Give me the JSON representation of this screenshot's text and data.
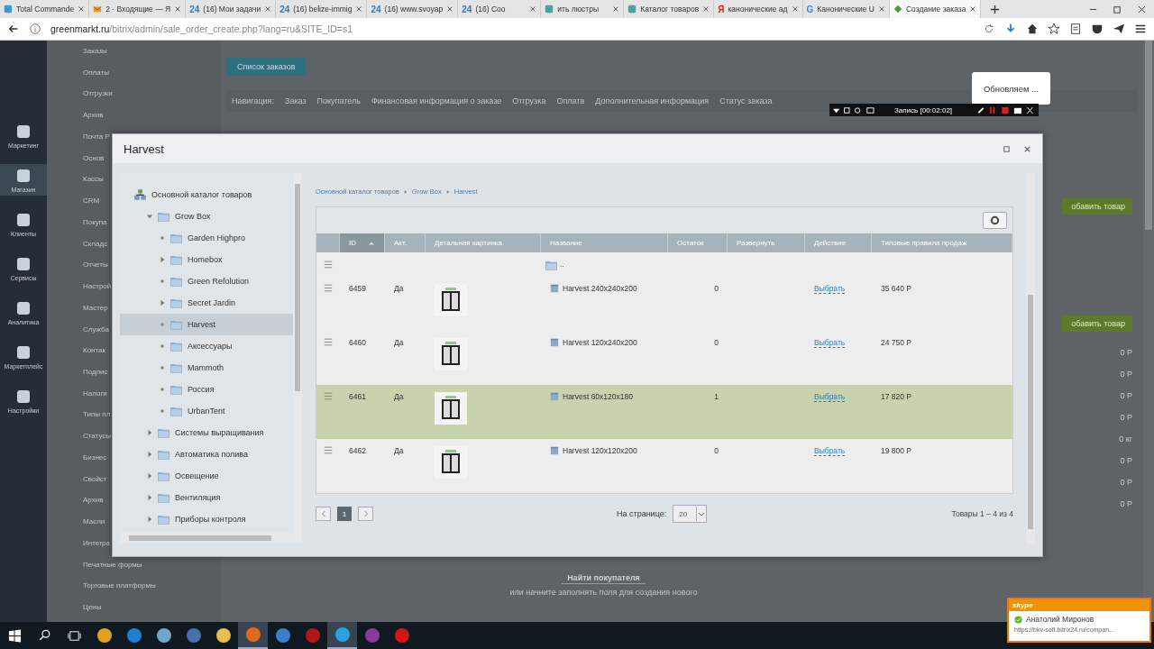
{
  "browser": {
    "tabs": [
      {
        "title": "Total Commande",
        "kind": "square",
        "selected": false
      },
      {
        "title": "2 · Входящие — Я",
        "kind": "envelope",
        "selected": false
      },
      {
        "title": "(16) Мои задачи",
        "kind": "logo",
        "logo": "24",
        "selected": false
      },
      {
        "title": "(16) belize-immig",
        "kind": "logo",
        "logo": "24",
        "selected": false
      },
      {
        "title": "(16) www.svoyap",
        "kind": "logo",
        "logo": "24",
        "selected": false
      },
      {
        "title": "(16) Соо",
        "kind": "logo",
        "logo": "24",
        "selected": false
      },
      {
        "title": "ить люстры",
        "kind": "square",
        "selected": false
      },
      {
        "title": "Каталог товаров",
        "kind": "square",
        "selected": false
      },
      {
        "title": "канонические ад",
        "kind": "logo",
        "logo": "Я",
        "selected": false
      },
      {
        "title": "Канонические U",
        "kind": "logo",
        "logo": "G",
        "selected": false
      },
      {
        "title": "Создание заказа",
        "kind": "leaf",
        "selected": true
      }
    ],
    "url_host": "greenmarkt.ru",
    "url_path": "/bitrix/admin/sale_order_create.php?lang=ru&SITE_ID=s1"
  },
  "rail": [
    {
      "label": "Маркетинг",
      "selected": false
    },
    {
      "label": "Магазин",
      "selected": true
    },
    {
      "label": "Клиенты",
      "selected": false
    },
    {
      "label": "Сервисы",
      "selected": false
    },
    {
      "label": "Аналитика",
      "selected": false
    },
    {
      "label": "Маркетплейс",
      "selected": false
    },
    {
      "label": "Настройки",
      "selected": false
    }
  ],
  "menu": [
    {
      "label": "Заказы"
    },
    {
      "label": "Оплаты"
    },
    {
      "label": "Отгрузки"
    },
    {
      "label": "Архив"
    },
    {
      "label": "Почта Р"
    },
    {
      "label": "Основ"
    },
    {
      "label": "Кассы"
    },
    {
      "label": "CRM"
    },
    {
      "label": "Покупа"
    },
    {
      "label": "Складс"
    },
    {
      "label": "Отчеты"
    },
    {
      "label": "Настрой"
    },
    {
      "label": "Мастер"
    },
    {
      "label": "Служба"
    },
    {
      "label": "Контак"
    },
    {
      "label": "Подпис"
    },
    {
      "label": "Налоги"
    },
    {
      "label": "Типы пл"
    },
    {
      "label": "Статусы"
    },
    {
      "label": "Бизнес"
    },
    {
      "label": "Свойст"
    },
    {
      "label": "Архив"
    },
    {
      "label": "Масли"
    },
    {
      "label": "Интегра"
    },
    {
      "label": "Печатные формы"
    },
    {
      "label": "Торговые платформы"
    },
    {
      "label": "Цены"
    }
  ],
  "orders_button": "Список заказов",
  "nav_label": "Навигация:",
  "nav": [
    "Заказ",
    "Покупатель",
    "Финансовая информация о заказе",
    "Отгрузка",
    "Оплата",
    "Дополнительная информация",
    "Статус заказа"
  ],
  "add_buttons": [
    "обавить товар",
    "обавить товар"
  ],
  "amounts": [
    "0 Р",
    "0 Р",
    "0 Р",
    "0 Р",
    "0 кг",
    "0 Р",
    "0 Р",
    "0 Р"
  ],
  "find_buyer": "Найти покупателя",
  "find_hint": "или начните заполнять поля для создания нового",
  "popup": "Обновляем ...",
  "recorder": "Запись [00:02:02]",
  "modal": {
    "title": "Harvest",
    "tree": [
      {
        "label": "Основной каталог товаров",
        "kind": "root",
        "selected": false,
        "children": [
          {
            "label": "Grow Box",
            "kind": "branch",
            "expanded": true,
            "selected": false,
            "children": [
              {
                "label": "Garden Highpro",
                "kind": "leaf",
                "selected": false
              },
              {
                "label": "Homebox",
                "kind": "branch",
                "expanded": false,
                "selected": false
              },
              {
                "label": "Green Refolution",
                "kind": "leaf",
                "selected": false
              },
              {
                "label": "Secret Jardin",
                "kind": "branch",
                "expanded": false,
                "selected": false
              },
              {
                "label": "Harvest",
                "kind": "leaf",
                "selected": true
              },
              {
                "label": "Аксессуары",
                "kind": "leaf",
                "selected": false
              },
              {
                "label": "Mammoth",
                "kind": "leaf",
                "selected": false
              },
              {
                "label": "Россия",
                "kind": "leaf",
                "selected": false
              },
              {
                "label": "UrbanTent",
                "kind": "leaf",
                "selected": false
              }
            ]
          },
          {
            "label": "Системы выращивания",
            "kind": "branch",
            "expanded": false,
            "selected": false
          },
          {
            "label": "Автоматика полива",
            "kind": "branch",
            "expanded": false,
            "selected": false
          },
          {
            "label": "Освещение",
            "kind": "branch",
            "expanded": false,
            "selected": false
          },
          {
            "label": "Вентиляция",
            "kind": "branch",
            "expanded": false,
            "selected": false
          },
          {
            "label": "Приборы контроля",
            "kind": "branch",
            "expanded": false,
            "selected": false
          }
        ]
      }
    ],
    "breadcrumb": [
      "Основной каталог товаров",
      "Grow Box",
      "Harvest"
    ],
    "columns": [
      {
        "sorted": false
      },
      {
        "label": "ID",
        "sorted": true
      },
      {
        "label": "Акт.",
        "sorted": false
      },
      {
        "label": "Детальная картинка",
        "sorted": false
      },
      {
        "label": "Название",
        "sorted": false
      },
      {
        "label": "Остаток",
        "sorted": false
      },
      {
        "label": "Развернуть",
        "sorted": false
      },
      {
        "label": "Действие",
        "sorted": false
      },
      {
        "label": "Типовые правила продаж",
        "sorted": false
      }
    ],
    "rows": [
      {
        "kind": "folder",
        "name": "..",
        "selected": false
      },
      {
        "kind": "product",
        "id": "6459",
        "active": "Да",
        "name": "Harvest 240x240x200",
        "stock": "0",
        "action": "Выбрать",
        "price": "35 640 Р",
        "selected": false
      },
      {
        "kind": "product",
        "id": "6460",
        "active": "Да",
        "name": "Harvest 120x240x200",
        "stock": "0",
        "action": "Выбрать",
        "price": "24 750 Р",
        "selected": false
      },
      {
        "kind": "product",
        "id": "6461",
        "active": "Да",
        "name": "Harvest 60x120x180",
        "stock": "1",
        "action": "Выбрать",
        "price": "17 820 Р",
        "selected": true
      },
      {
        "kind": "product",
        "id": "6462",
        "active": "Да",
        "name": "Harvest 120x120x200",
        "stock": "0",
        "action": "Выбрать",
        "price": "19 800 Р",
        "selected": false
      }
    ],
    "pages": [
      {
        "label": "1",
        "selected": true
      }
    ],
    "per_page_label": "На странице:",
    "per_page": "20",
    "total": "Товары 1 – 4 из 4"
  },
  "taskbar": [
    {
      "kind": "windows",
      "active": false
    },
    {
      "kind": "search",
      "active": false
    },
    {
      "kind": "taskview",
      "active": false
    },
    {
      "kind": "app",
      "color": "#e0a020",
      "active": false
    },
    {
      "kind": "app",
      "color": "#1e7fd0",
      "active": false
    },
    {
      "kind": "app",
      "color": "#6fa8c8",
      "active": false
    },
    {
      "kind": "app",
      "color": "#4a6fa8",
      "active": false
    },
    {
      "kind": "app",
      "color": "#e8c050",
      "active": false
    },
    {
      "kind": "app",
      "color": "#e06a1a",
      "active": true
    },
    {
      "kind": "app",
      "color": "#3a7fc8",
      "active": false
    },
    {
      "kind": "app",
      "color": "#b01818",
      "active": false
    },
    {
      "kind": "app",
      "color": "#2aa0e0",
      "active": true
    },
    {
      "kind": "app",
      "color": "#8a3a9a",
      "active": false
    },
    {
      "kind": "app",
      "color": "#d01818",
      "active": false
    }
  ],
  "skype": {
    "brand": "skype",
    "name": "Анатолий Миронов",
    "link": "https://bkv-soft.bitrix24.ru/compan..."
  }
}
